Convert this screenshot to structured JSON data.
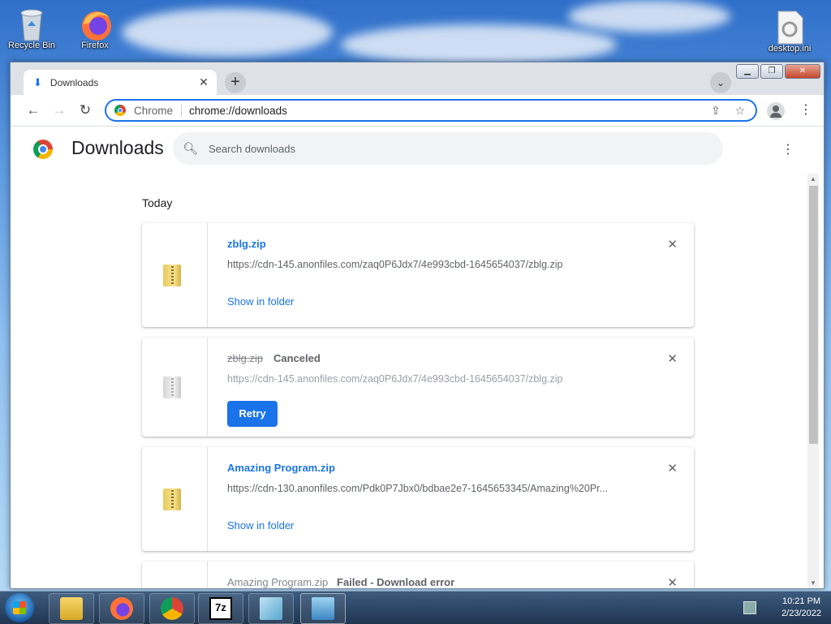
{
  "desktop": {
    "icons": [
      {
        "label": "Recycle Bin"
      },
      {
        "label": "Firefox"
      },
      {
        "label": "desktop.ini"
      }
    ]
  },
  "browser": {
    "tab": {
      "title": "Downloads",
      "icon": "download-icon"
    },
    "toolbar": {
      "chip_label": "Chrome",
      "url": "chrome://downloads"
    }
  },
  "downloads_page": {
    "title": "Downloads",
    "search_placeholder": "Search downloads",
    "section_label": "Today",
    "items": [
      {
        "file_name": "zblg.zip",
        "status": "",
        "url": "https://cdn-145.anonfiles.com/zaq0P6Jdx7/4e993cbd-1645654037/zblg.zip",
        "action": "Show in folder"
      },
      {
        "file_name": "zblg.zip",
        "status": "Canceled",
        "url": "https://cdn-145.anonfiles.com/zaq0P6Jdx7/4e993cbd-1645654037/zblg.zip",
        "action": "Retry"
      },
      {
        "file_name": "Amazing Program.zip",
        "status": "",
        "url": "https://cdn-130.anonfiles.com/Pdk0P7Jbx0/bdbae2e7-1645653345/Amazing%20Pr...",
        "action": "Show in folder"
      },
      {
        "file_name": "Amazing Program.zip",
        "status": "Failed - Download error"
      }
    ]
  },
  "taskbar": {
    "time": "10:21 PM",
    "date": "2/23/2022",
    "pinned": [
      "windows-explorer",
      "firefox",
      "chrome",
      "7zip",
      "notepad",
      "network"
    ]
  }
}
